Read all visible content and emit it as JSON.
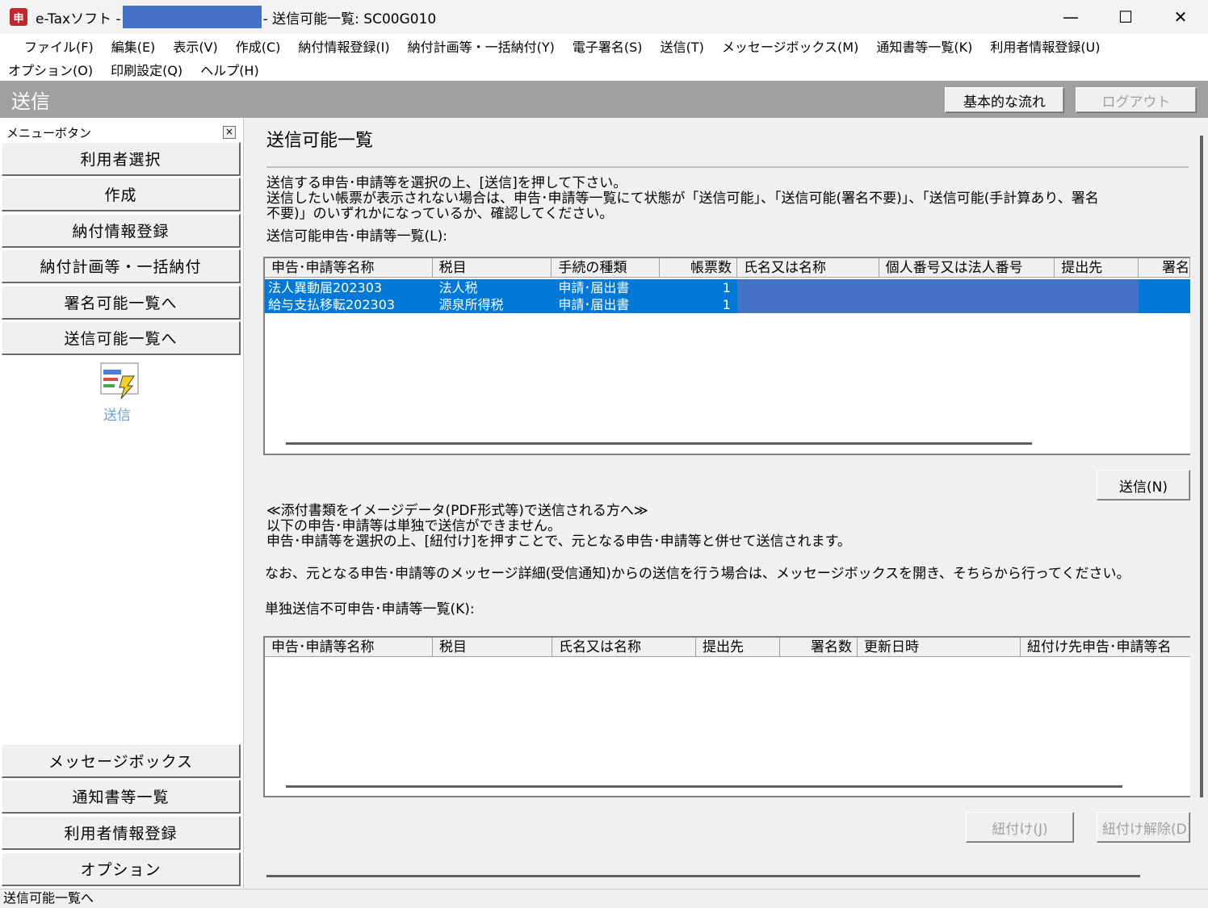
{
  "window": {
    "title_prefix": "e-Taxソフト -",
    "title_suffix": "- 送信可能一覧: SC00G010",
    "minimize": "—",
    "maximize": "☐",
    "close": "✕"
  },
  "menu": {
    "row1": [
      "ファイル(F)",
      "編集(E)",
      "表示(V)",
      "作成(C)",
      "納付情報登録(I)",
      "納付計画等・一括納付(Y)",
      "電子署名(S)",
      "送信(T)",
      "メッセージボックス(M)",
      "通知書等一覧(K)",
      "利用者情報登録(U)"
    ],
    "row2": [
      "オプション(O)",
      "印刷設定(Q)",
      "ヘルプ(H)"
    ]
  },
  "header": {
    "title": "送信",
    "basic_flow_button": "基本的な流れ",
    "logout_button": "ログアウト"
  },
  "left": {
    "caption": "メニューボタン",
    "close": "×",
    "nav_top": [
      "利用者選択",
      "作成",
      "納付情報登録",
      "納付計画等・一括納付",
      "署名可能一覧へ",
      "送信可能一覧へ"
    ],
    "send_icon_label": "送信",
    "nav_bottom": [
      "メッセージボックス",
      "通知書等一覧",
      "利用者情報登録",
      "オプション"
    ]
  },
  "main": {
    "title": "送信可能一覧",
    "desc1": "送信する申告･申請等を選択の上、[送信]を押して下さい。",
    "desc2": "送信したい帳票が表示されない場合は、申告･申請等一覧にて状態が「送信可能」、「送信可能(署名不要)」、「送信可能(手計算あり、署名",
    "desc3": "不要)」のいずれかになっているか、確認してください。",
    "list1_label": "送信可能申告･申請等一覧(L):",
    "grid1": {
      "headers": [
        "申告･申請等名称",
        "税目",
        "手続の種類",
        "帳票数",
        "氏名又は名称",
        "個人番号又は法人番号",
        "提出先",
        "署名"
      ],
      "rows": [
        [
          "法人異動届202303",
          "法人税",
          "申請･届出書",
          "1"
        ],
        [
          "給与支払移転202303",
          "源泉所得税",
          "申請･届出書",
          "1"
        ]
      ]
    },
    "send_button": "送信(N)",
    "attach1": "≪添付書類をイメージデータ(PDF形式等)で送信される方へ≫",
    "attach2": "以下の申告･申請等は単独で送信ができません。",
    "attach3": "申告･申請等を選択の上、[紐付け]を押すことで、元となる申告･申請等と併せて送信されます。",
    "attach4": "なお、元となる申告･申請等のメッセージ詳細(受信通知)からの送信を行う場合は、メッセージボックスを開き、そちらから行ってください。",
    "list2_label": "単独送信不可申告･申請等一覧(K):",
    "grid2": {
      "headers": [
        "申告･申請等名称",
        "税目",
        "氏名又は名称",
        "提出先",
        "署名数",
        "更新日時",
        "紐付け先申告･申請等名"
      ]
    },
    "link_button": "紐付け(J)",
    "unlink_button": "紐付け解除(D)"
  },
  "status": {
    "text": "送信可能一覧へ"
  },
  "colors": {
    "selection": "#0078d7",
    "redaction": "#4472c4",
    "header_strip": "#a0a0a0"
  }
}
